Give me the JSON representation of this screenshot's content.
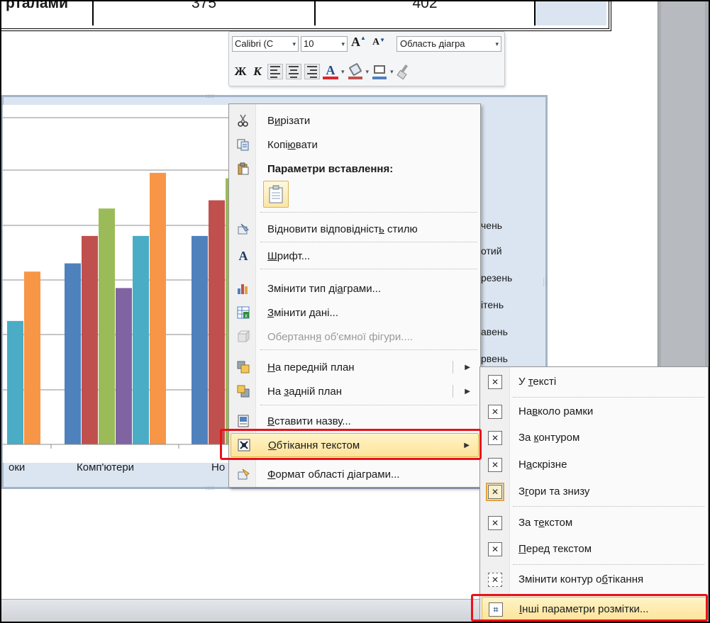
{
  "table": {
    "row_label": "ртaлами",
    "value_a": "375",
    "value_b": "402"
  },
  "mini_toolbar": {
    "font_name": "Calibri (С",
    "font_size": "10",
    "style_selector": "Область діагра",
    "bold": "Ж",
    "italic": "К",
    "grow": "A",
    "shrink": "A",
    "font_color_glyph": "A",
    "dropdown_glyph": "▾"
  },
  "chart": {
    "category_labels": [
      "оки",
      "Комп'ютери",
      "Но"
    ],
    "legend_items": [
      "чень",
      "отий",
      "резень",
      "ітень",
      "авень",
      "рвень"
    ],
    "series_colors": [
      "#4f81bd",
      "#c0504d",
      "#9bbb59",
      "#8064a2",
      "#4bacc6",
      "#f79646"
    ]
  },
  "chart_data": {
    "type": "bar",
    "categories": [
      "оки",
      "Комп'ютери",
      "Но"
    ],
    "series": [
      {
        "name": "",
        "color": "#4bacc6",
        "values": [
          0.45,
          null,
          null
        ]
      },
      {
        "name": "",
        "color": "#f79646",
        "values": [
          0.63,
          null,
          null
        ]
      },
      {
        "name": "",
        "color": "#4f81bd",
        "values": [
          null,
          0.66,
          0.76
        ]
      },
      {
        "name": "",
        "color": "#c0504d",
        "values": [
          null,
          0.76,
          0.89
        ]
      },
      {
        "name": "",
        "color": "#9bbb59",
        "values": [
          null,
          0.86,
          0.97
        ]
      },
      {
        "name": "",
        "color": "#8064a2",
        "values": [
          null,
          0.57,
          null
        ]
      },
      {
        "name": "",
        "color": "#4bacc6",
        "values": [
          null,
          0.76,
          null
        ]
      },
      {
        "name": "",
        "color": "#f79646",
        "values": [
          null,
          0.99,
          null
        ]
      }
    ],
    "grid": true
  },
  "context_menu": {
    "items": [
      {
        "label_pre": "В",
        "label_u": "и",
        "label_post": "різати",
        "icon": "scissors-icon"
      },
      {
        "label_pre": "Копі",
        "label_u": "ю",
        "label_post": "вати",
        "icon": "copy-icon"
      },
      {
        "label_pre": "Параметри вставлення:",
        "label_u": "",
        "label_post": "",
        "icon": "paste-icon"
      },
      {
        "label_pre": "Відновити відповідніст",
        "label_u": "ь",
        "label_post": " стилю",
        "icon": "reset-style-icon"
      },
      {
        "label_pre": "",
        "label_u": "Ш",
        "label_post": "рифт...",
        "icon": "font-icon"
      },
      {
        "label_pre": "Змінити тип ді",
        "label_u": "а",
        "label_post": "грами...",
        "icon": "chart-type-icon"
      },
      {
        "label_pre": "",
        "label_u": "З",
        "label_post": "мінити дані...",
        "icon": "edit-data-icon"
      },
      {
        "label_pre": "Обертанн",
        "label_u": "я",
        "label_post": " об'ємної фігури....",
        "icon": "3d-rotation-icon"
      },
      {
        "label_pre": "",
        "label_u": "Н",
        "label_post": "а передній план",
        "icon": "bring-forward-icon"
      },
      {
        "label_pre": "На ",
        "label_u": "з",
        "label_post": "адній план",
        "icon": "send-backward-icon"
      },
      {
        "label_pre": "",
        "label_u": "В",
        "label_post": "ставити назву...",
        "icon": "insert-caption-icon"
      },
      {
        "label_pre": "",
        "label_u": "О",
        "label_post": "бтікання текстом",
        "icon": "text-wrap-icon"
      },
      {
        "label_pre": "",
        "label_u": "Ф",
        "label_post": "ормат області діаграми...",
        "icon": "format-chart-area-icon"
      }
    ]
  },
  "submenu": {
    "items": [
      {
        "label_pre": "У ",
        "label_u": "т",
        "label_post": "ексті"
      },
      {
        "label_pre": "На",
        "label_u": "в",
        "label_post": "коло рамки"
      },
      {
        "label_pre": "За ",
        "label_u": "к",
        "label_post": "онтуром"
      },
      {
        "label_pre": "Н",
        "label_u": "а",
        "label_post": "скрізне"
      },
      {
        "label_pre": "З",
        "label_u": "г",
        "label_post": "ори та знизу"
      },
      {
        "label_pre": "За т",
        "label_u": "е",
        "label_post": "кстом"
      },
      {
        "label_pre": "",
        "label_u": "П",
        "label_post": "еред текстом"
      },
      {
        "label_pre": "Змінити контур о",
        "label_u": "б",
        "label_post": "тікання"
      },
      {
        "label_pre": "",
        "label_u": "І",
        "label_post": "нші параметри розмітки..."
      }
    ]
  }
}
